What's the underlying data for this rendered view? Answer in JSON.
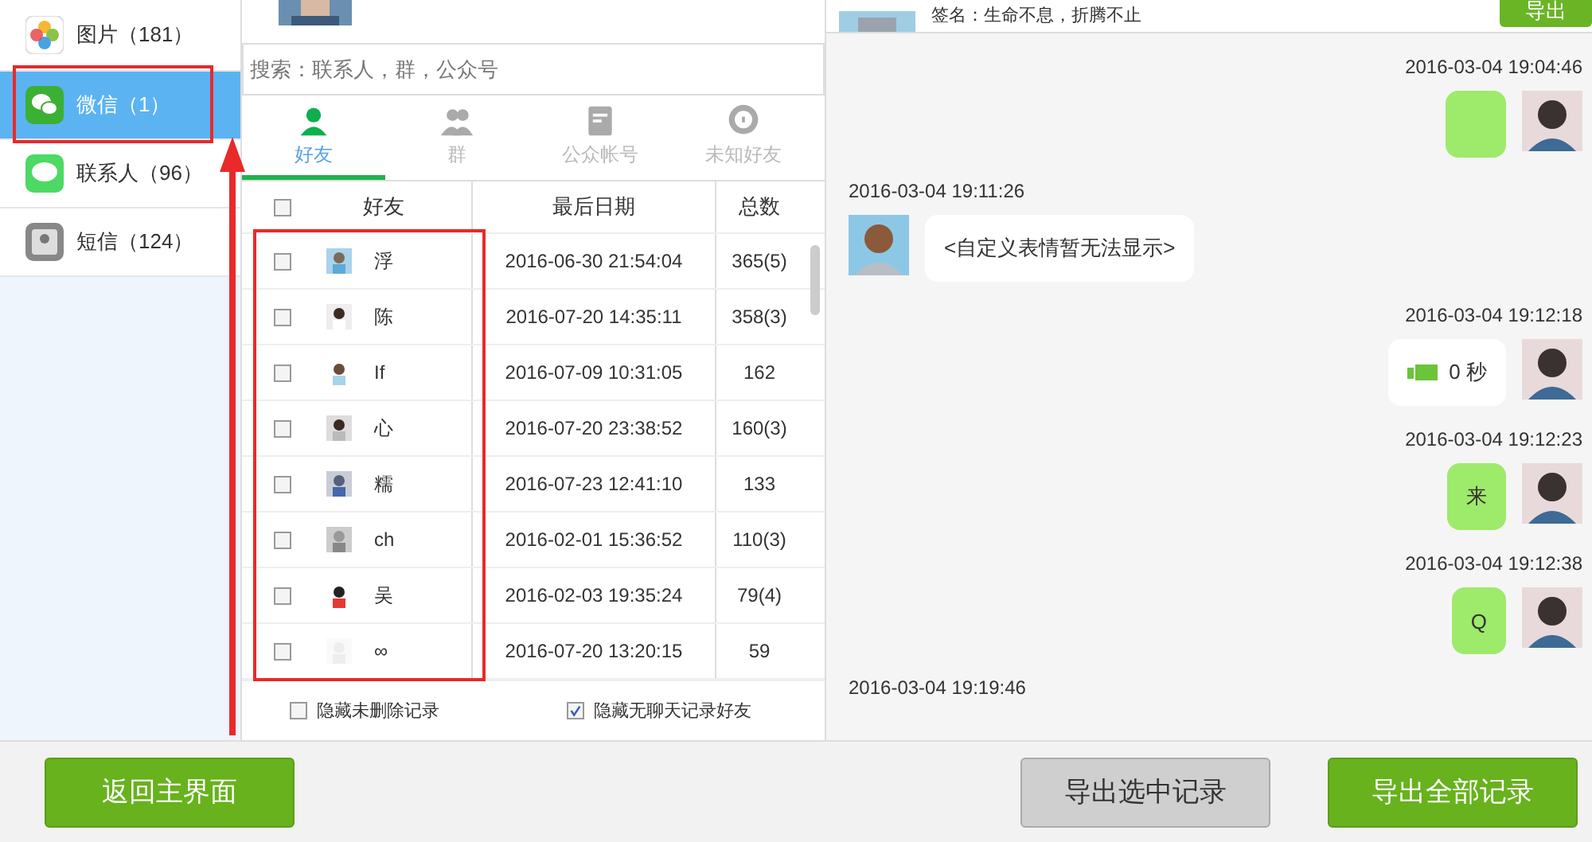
{
  "sidebar": {
    "items": [
      {
        "label": "图片（181）",
        "selected": false
      },
      {
        "label": "微信（1）",
        "selected": true
      },
      {
        "label": "联系人（96）",
        "selected": false
      },
      {
        "label": "短信（124）",
        "selected": false
      }
    ]
  },
  "search": {
    "placeholder": "搜索：联系人，群，公众号"
  },
  "tabs": [
    {
      "label": "好友",
      "selected": true
    },
    {
      "label": "群",
      "selected": false
    },
    {
      "label": "公众帐号",
      "selected": false
    },
    {
      "label": "未知好友",
      "selected": false
    }
  ],
  "table": {
    "select_all": {
      "checked": false
    },
    "columns": [
      "好友",
      "最后日期",
      "总数"
    ],
    "rows": [
      {
        "checked": false,
        "name": "浮",
        "date": "2016-06-30 21:54:04",
        "count": "365(5)"
      },
      {
        "checked": false,
        "name": "陈",
        "date": "2016-07-20 14:35:11",
        "count": "358(3)"
      },
      {
        "checked": false,
        "name": "If",
        "date": "2016-07-09 10:31:05",
        "count": "162"
      },
      {
        "checked": false,
        "name": "心",
        "date": "2016-07-20 23:38:52",
        "count": "160(3)"
      },
      {
        "checked": false,
        "name": "糯",
        "date": "2016-07-23 12:41:10",
        "count": "133"
      },
      {
        "checked": false,
        "name": "ch",
        "date": "2016-02-01 15:36:52",
        "count": "110(3)"
      },
      {
        "checked": false,
        "name": "吴",
        "date": "2016-02-03 19:35:24",
        "count": "79(4)"
      },
      {
        "checked": false,
        "name": "∞",
        "date": "2016-07-20 13:20:15",
        "count": "59"
      }
    ]
  },
  "options": [
    {
      "label": "隐藏未删除记录",
      "checked": false
    },
    {
      "label": "隐藏无聊天记录好友",
      "checked": true
    }
  ],
  "chat": {
    "signature": "签名：生命不息，折腾不止",
    "export_button": "导出",
    "messages": [
      {
        "time": "2016-03-04 19:04:46",
        "kind": "sent_blank"
      },
      {
        "time": "2016-03-04 19:11:26",
        "kind": "received",
        "text": "<自定义表情暂无法显示>"
      },
      {
        "time": "2016-03-04 19:12:18",
        "kind": "sent_voice",
        "text": "0 秒"
      },
      {
        "time": "2016-03-04 19:12:23",
        "kind": "sent",
        "text": "来"
      },
      {
        "time": "2016-03-04 19:12:38",
        "kind": "sent",
        "text": "Q"
      },
      {
        "time": "2016-03-04 19:19:46",
        "kind": "received_hidden"
      }
    ]
  },
  "buttons": {
    "back": "返回主界面",
    "export_selected": "导出选中记录",
    "export_all": "导出全部记录"
  }
}
